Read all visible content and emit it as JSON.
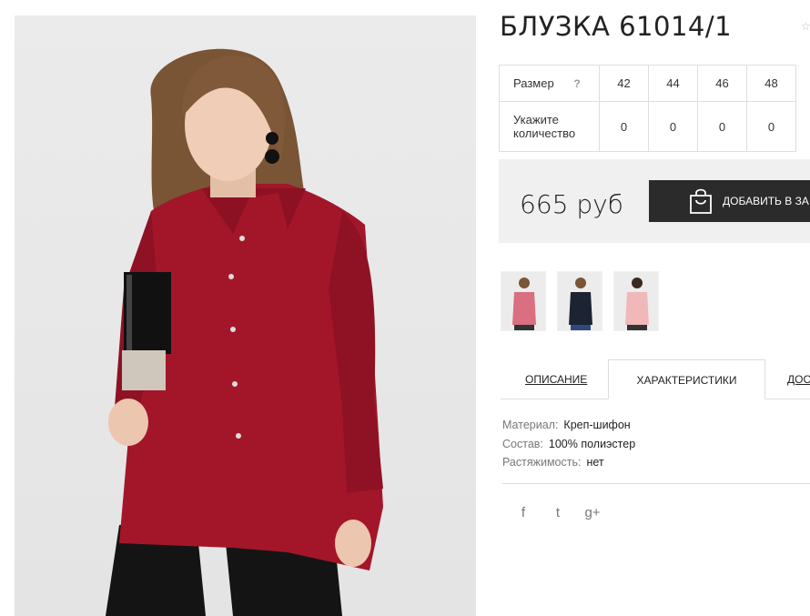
{
  "product": {
    "title": "БЛУЗКА 61014/1",
    "photo_icon": "product-photo-red-blouse"
  },
  "sizes": {
    "label": "Размер",
    "help": "?",
    "values": [
      "42",
      "44",
      "46",
      "48"
    ],
    "qty_label": "Укажите количество",
    "qty": [
      "0",
      "0",
      "0",
      "0"
    ]
  },
  "price": {
    "value": "665 руб",
    "cart_label": "ДОБАВИТЬ В ЗА",
    "cart_icon": "shopping-bag-icon"
  },
  "tabs": [
    "ОПИСАНИЕ",
    "ХАРАКТЕРИСТИКИ",
    "ДОС"
  ],
  "specs": [
    {
      "key": "Материал:",
      "value": "Креп-шифон"
    },
    {
      "key": "Состав:",
      "value": "100% полиэстер"
    },
    {
      "key": "Растяжимость:",
      "value": "нет"
    }
  ],
  "social": [
    "f",
    "t",
    "g+"
  ],
  "colors": {
    "accent": "#a3162a",
    "button": "#2b2b2b",
    "price_bg": "#f0f0f0"
  }
}
